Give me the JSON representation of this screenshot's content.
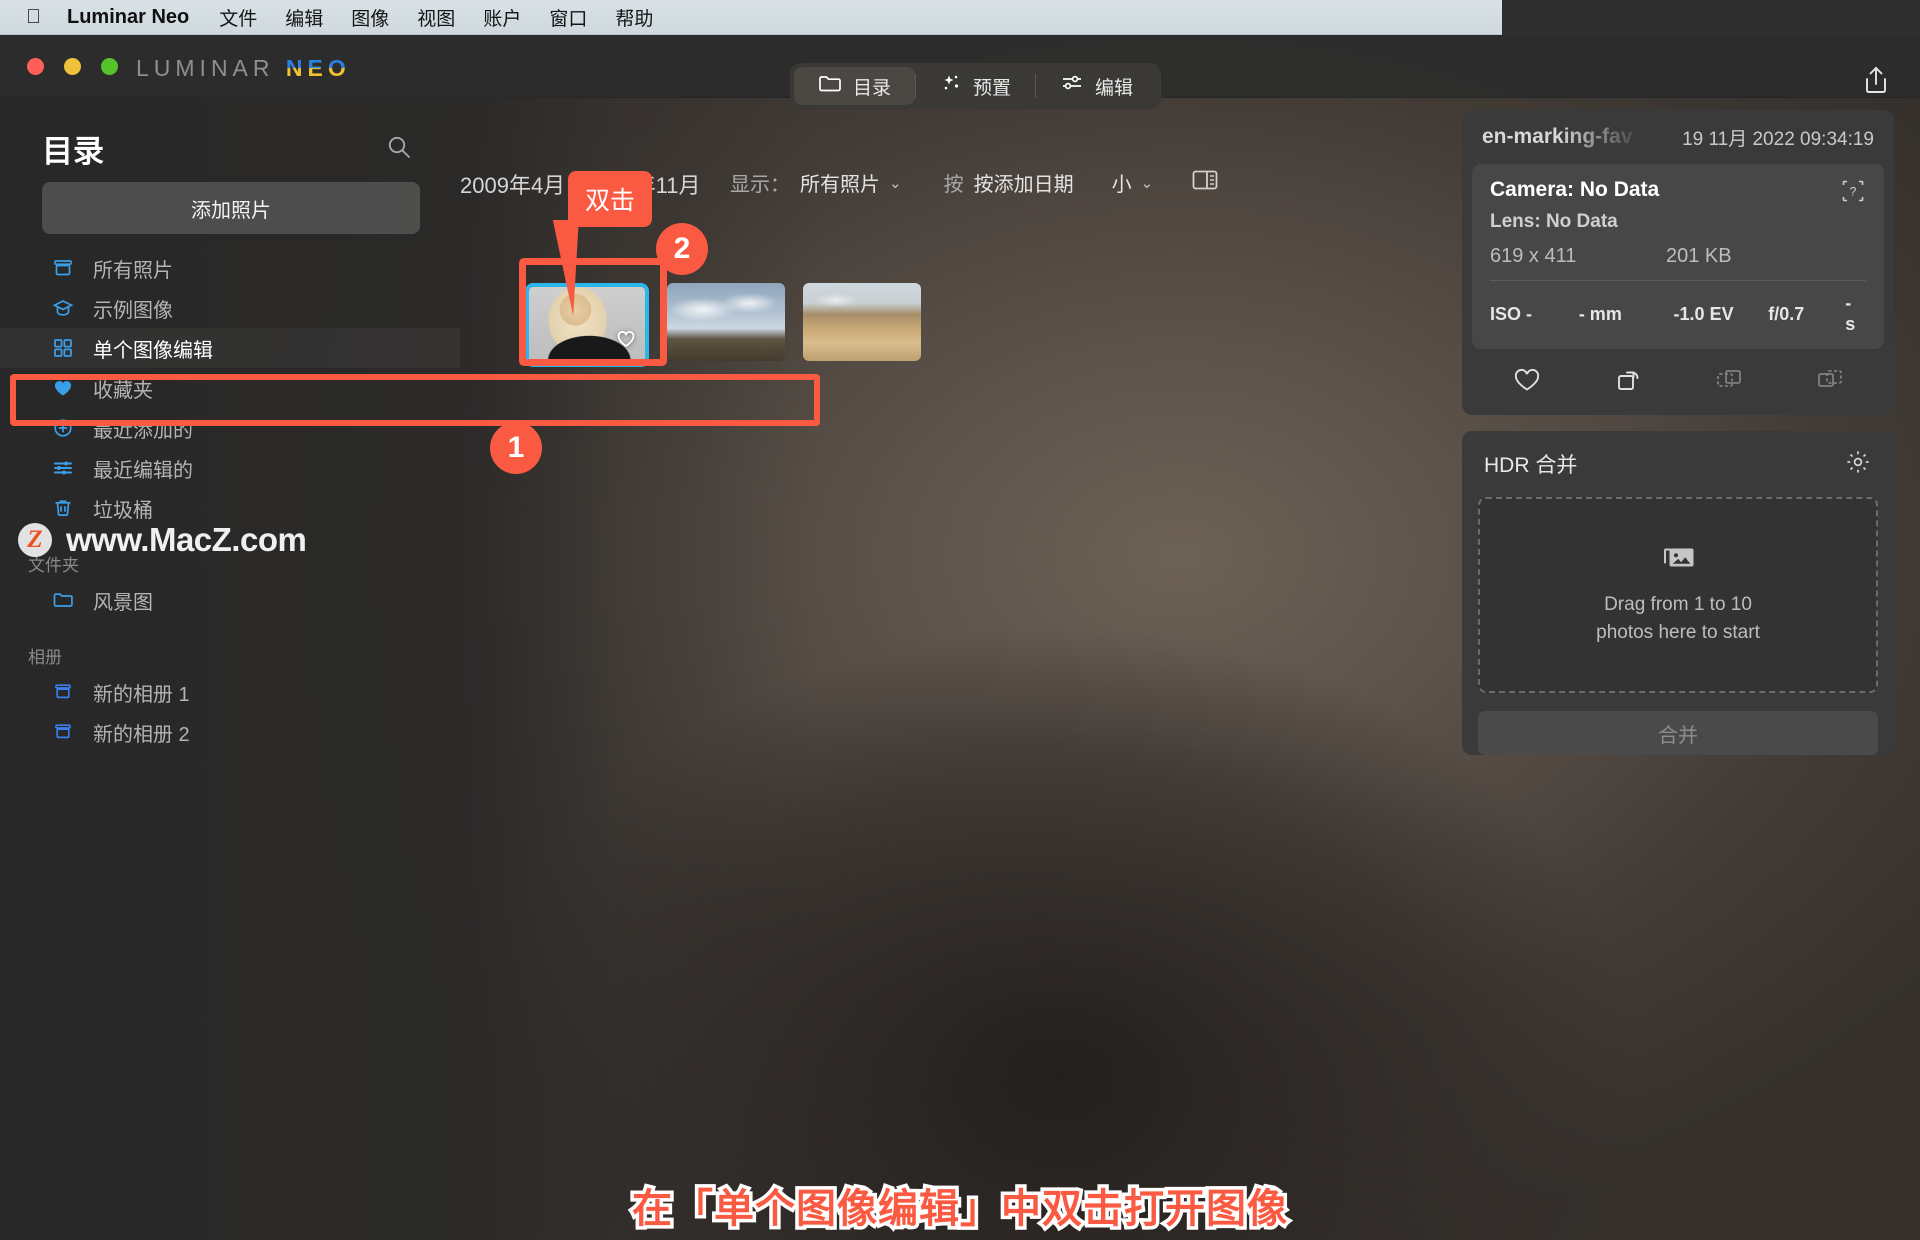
{
  "menubar": {
    "apple_icon": "apple-logo",
    "app_name": "Luminar Neo",
    "items": [
      "文件",
      "编辑",
      "图像",
      "视图",
      "账户",
      "窗口",
      "帮助"
    ]
  },
  "titlebar": {
    "brand_primary": "LUMINAR",
    "brand_accent": "NEO",
    "tabs": [
      {
        "label": "目录",
        "icon": "folder-icon",
        "active": true
      },
      {
        "label": "预置",
        "icon": "sparkle-icon",
        "active": false
      },
      {
        "label": "编辑",
        "icon": "sliders-icon",
        "active": false
      }
    ],
    "share_icon": "share-icon"
  },
  "sidebar": {
    "title": "目录",
    "search_icon": "search-icon",
    "add_photos_label": "添加照片",
    "items": [
      {
        "label": "所有照片",
        "icon": "archive-icon",
        "selected": false
      },
      {
        "label": "示例图像",
        "icon": "graduation-cap-icon",
        "selected": false
      },
      {
        "label": "单个图像编辑",
        "icon": "grid-icon",
        "selected": true
      },
      {
        "label": "收藏夹",
        "icon": "heart-icon",
        "selected": false
      },
      {
        "label": "最近添加的",
        "icon": "plus-circle-icon",
        "selected": false
      },
      {
        "label": "最近编辑的",
        "icon": "sliders-icon",
        "selected": false
      },
      {
        "label": "垃圾桶",
        "icon": "trash-icon",
        "selected": false
      }
    ],
    "folders_header": "文件夹",
    "folders": [
      {
        "label": "风景图",
        "icon": "folder-icon"
      }
    ],
    "albums_header": "相册",
    "albums": [
      {
        "label": "新的相册 1",
        "icon": "album-icon"
      },
      {
        "label": "新的相册 2",
        "icon": "album-icon"
      }
    ]
  },
  "watermark": {
    "badge_letter": "Z",
    "text": "www.MacZ.com"
  },
  "filterbar": {
    "date_range": "2009年4月 - 2022年11月",
    "show_label": "显示：",
    "show_value": "所有照片",
    "sort_label": "按",
    "sort_value": "按添加日期",
    "size_value": "小",
    "panel_toggle_icon": "split-panel-icon"
  },
  "thumbnails": [
    {
      "name": "portrait-thumbnail",
      "selected": true,
      "favorite_icon": "heart-icon"
    },
    {
      "name": "landscape-field-thumbnail",
      "selected": false
    },
    {
      "name": "landscape-desert-thumbnail",
      "selected": false
    }
  ],
  "inspector": {
    "filename": "en-marking-fav",
    "date": "19 11月 2022 09:34:19",
    "camera": "Camera: No Data",
    "lens": "Lens: No Data",
    "dimensions": "619 x 411",
    "filesize": "201 KB",
    "help_icon": "help-icon",
    "exif": [
      "ISO -",
      "- mm",
      "-1.0 EV",
      "f/0.7",
      "- s"
    ],
    "actions": [
      {
        "icon": "heart-icon",
        "dim": false
      },
      {
        "icon": "rotate-icon",
        "dim": false
      },
      {
        "icon": "copy-dashed-icon",
        "dim": true
      },
      {
        "icon": "copy-layers-icon",
        "dim": true
      }
    ],
    "hdr": {
      "title": "HDR 合并",
      "settings_icon": "gear-icon",
      "dropzone_icon": "photos-stack-icon",
      "dropzone_text": "Drag from 1 to 10\nphotos here to start",
      "merge_label": "合并"
    }
  },
  "annotations": {
    "badge_1": "1",
    "badge_2": "2",
    "callout": "双击",
    "caption": "在「单个图像编辑」中双击打开图像",
    "accent_color": "#fb5a42"
  }
}
